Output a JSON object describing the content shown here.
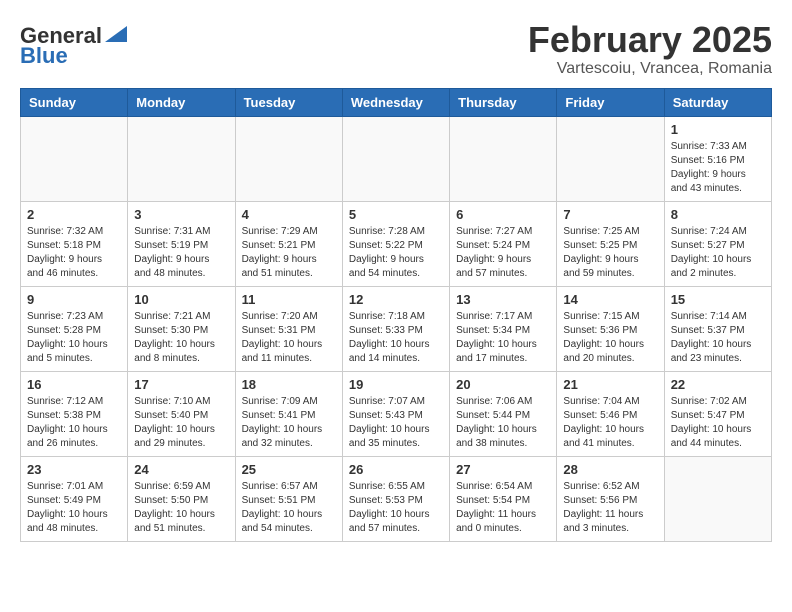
{
  "header": {
    "logo_line1": "General",
    "logo_line2": "Blue",
    "month_title": "February 2025",
    "location": "Vartescoiu, Vrancea, Romania"
  },
  "weekdays": [
    "Sunday",
    "Monday",
    "Tuesday",
    "Wednesday",
    "Thursday",
    "Friday",
    "Saturday"
  ],
  "weeks": [
    [
      {
        "day": "",
        "info": ""
      },
      {
        "day": "",
        "info": ""
      },
      {
        "day": "",
        "info": ""
      },
      {
        "day": "",
        "info": ""
      },
      {
        "day": "",
        "info": ""
      },
      {
        "day": "",
        "info": ""
      },
      {
        "day": "1",
        "info": "Sunrise: 7:33 AM\nSunset: 5:16 PM\nDaylight: 9 hours and 43 minutes."
      }
    ],
    [
      {
        "day": "2",
        "info": "Sunrise: 7:32 AM\nSunset: 5:18 PM\nDaylight: 9 hours and 46 minutes."
      },
      {
        "day": "3",
        "info": "Sunrise: 7:31 AM\nSunset: 5:19 PM\nDaylight: 9 hours and 48 minutes."
      },
      {
        "day": "4",
        "info": "Sunrise: 7:29 AM\nSunset: 5:21 PM\nDaylight: 9 hours and 51 minutes."
      },
      {
        "day": "5",
        "info": "Sunrise: 7:28 AM\nSunset: 5:22 PM\nDaylight: 9 hours and 54 minutes."
      },
      {
        "day": "6",
        "info": "Sunrise: 7:27 AM\nSunset: 5:24 PM\nDaylight: 9 hours and 57 minutes."
      },
      {
        "day": "7",
        "info": "Sunrise: 7:25 AM\nSunset: 5:25 PM\nDaylight: 9 hours and 59 minutes."
      },
      {
        "day": "8",
        "info": "Sunrise: 7:24 AM\nSunset: 5:27 PM\nDaylight: 10 hours and 2 minutes."
      }
    ],
    [
      {
        "day": "9",
        "info": "Sunrise: 7:23 AM\nSunset: 5:28 PM\nDaylight: 10 hours and 5 minutes."
      },
      {
        "day": "10",
        "info": "Sunrise: 7:21 AM\nSunset: 5:30 PM\nDaylight: 10 hours and 8 minutes."
      },
      {
        "day": "11",
        "info": "Sunrise: 7:20 AM\nSunset: 5:31 PM\nDaylight: 10 hours and 11 minutes."
      },
      {
        "day": "12",
        "info": "Sunrise: 7:18 AM\nSunset: 5:33 PM\nDaylight: 10 hours and 14 minutes."
      },
      {
        "day": "13",
        "info": "Sunrise: 7:17 AM\nSunset: 5:34 PM\nDaylight: 10 hours and 17 minutes."
      },
      {
        "day": "14",
        "info": "Sunrise: 7:15 AM\nSunset: 5:36 PM\nDaylight: 10 hours and 20 minutes."
      },
      {
        "day": "15",
        "info": "Sunrise: 7:14 AM\nSunset: 5:37 PM\nDaylight: 10 hours and 23 minutes."
      }
    ],
    [
      {
        "day": "16",
        "info": "Sunrise: 7:12 AM\nSunset: 5:38 PM\nDaylight: 10 hours and 26 minutes."
      },
      {
        "day": "17",
        "info": "Sunrise: 7:10 AM\nSunset: 5:40 PM\nDaylight: 10 hours and 29 minutes."
      },
      {
        "day": "18",
        "info": "Sunrise: 7:09 AM\nSunset: 5:41 PM\nDaylight: 10 hours and 32 minutes."
      },
      {
        "day": "19",
        "info": "Sunrise: 7:07 AM\nSunset: 5:43 PM\nDaylight: 10 hours and 35 minutes."
      },
      {
        "day": "20",
        "info": "Sunrise: 7:06 AM\nSunset: 5:44 PM\nDaylight: 10 hours and 38 minutes."
      },
      {
        "day": "21",
        "info": "Sunrise: 7:04 AM\nSunset: 5:46 PM\nDaylight: 10 hours and 41 minutes."
      },
      {
        "day": "22",
        "info": "Sunrise: 7:02 AM\nSunset: 5:47 PM\nDaylight: 10 hours and 44 minutes."
      }
    ],
    [
      {
        "day": "23",
        "info": "Sunrise: 7:01 AM\nSunset: 5:49 PM\nDaylight: 10 hours and 48 minutes."
      },
      {
        "day": "24",
        "info": "Sunrise: 6:59 AM\nSunset: 5:50 PM\nDaylight: 10 hours and 51 minutes."
      },
      {
        "day": "25",
        "info": "Sunrise: 6:57 AM\nSunset: 5:51 PM\nDaylight: 10 hours and 54 minutes."
      },
      {
        "day": "26",
        "info": "Sunrise: 6:55 AM\nSunset: 5:53 PM\nDaylight: 10 hours and 57 minutes."
      },
      {
        "day": "27",
        "info": "Sunrise: 6:54 AM\nSunset: 5:54 PM\nDaylight: 11 hours and 0 minutes."
      },
      {
        "day": "28",
        "info": "Sunrise: 6:52 AM\nSunset: 5:56 PM\nDaylight: 11 hours and 3 minutes."
      },
      {
        "day": "",
        "info": ""
      }
    ]
  ]
}
